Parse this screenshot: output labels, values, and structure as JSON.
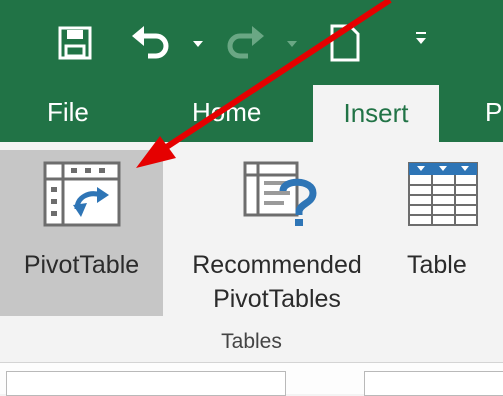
{
  "quick_access": {
    "save_icon": "save-icon",
    "undo_icon": "undo-icon",
    "redo_icon": "redo-icon",
    "new_icon": "new-document-icon",
    "customize_icon": "customize-qat-icon"
  },
  "tabs": [
    {
      "label": "File"
    },
    {
      "label": "Home"
    },
    {
      "label": "Insert",
      "active": true
    },
    {
      "label": "Pa"
    }
  ],
  "tables_group": {
    "pivot_table_label": "PivotTable",
    "recommended_label_line1": "Recommended",
    "recommended_label_line2": "PivotTables",
    "table_label": "Table",
    "group_label": "Tables"
  },
  "annotation": {
    "arrow_color": "#e50000"
  },
  "colors": {
    "accent": "#217346",
    "ribbon": "#f3f3f3",
    "pressed": "#c6c6c6",
    "icon_blue": "#2e75b6"
  }
}
